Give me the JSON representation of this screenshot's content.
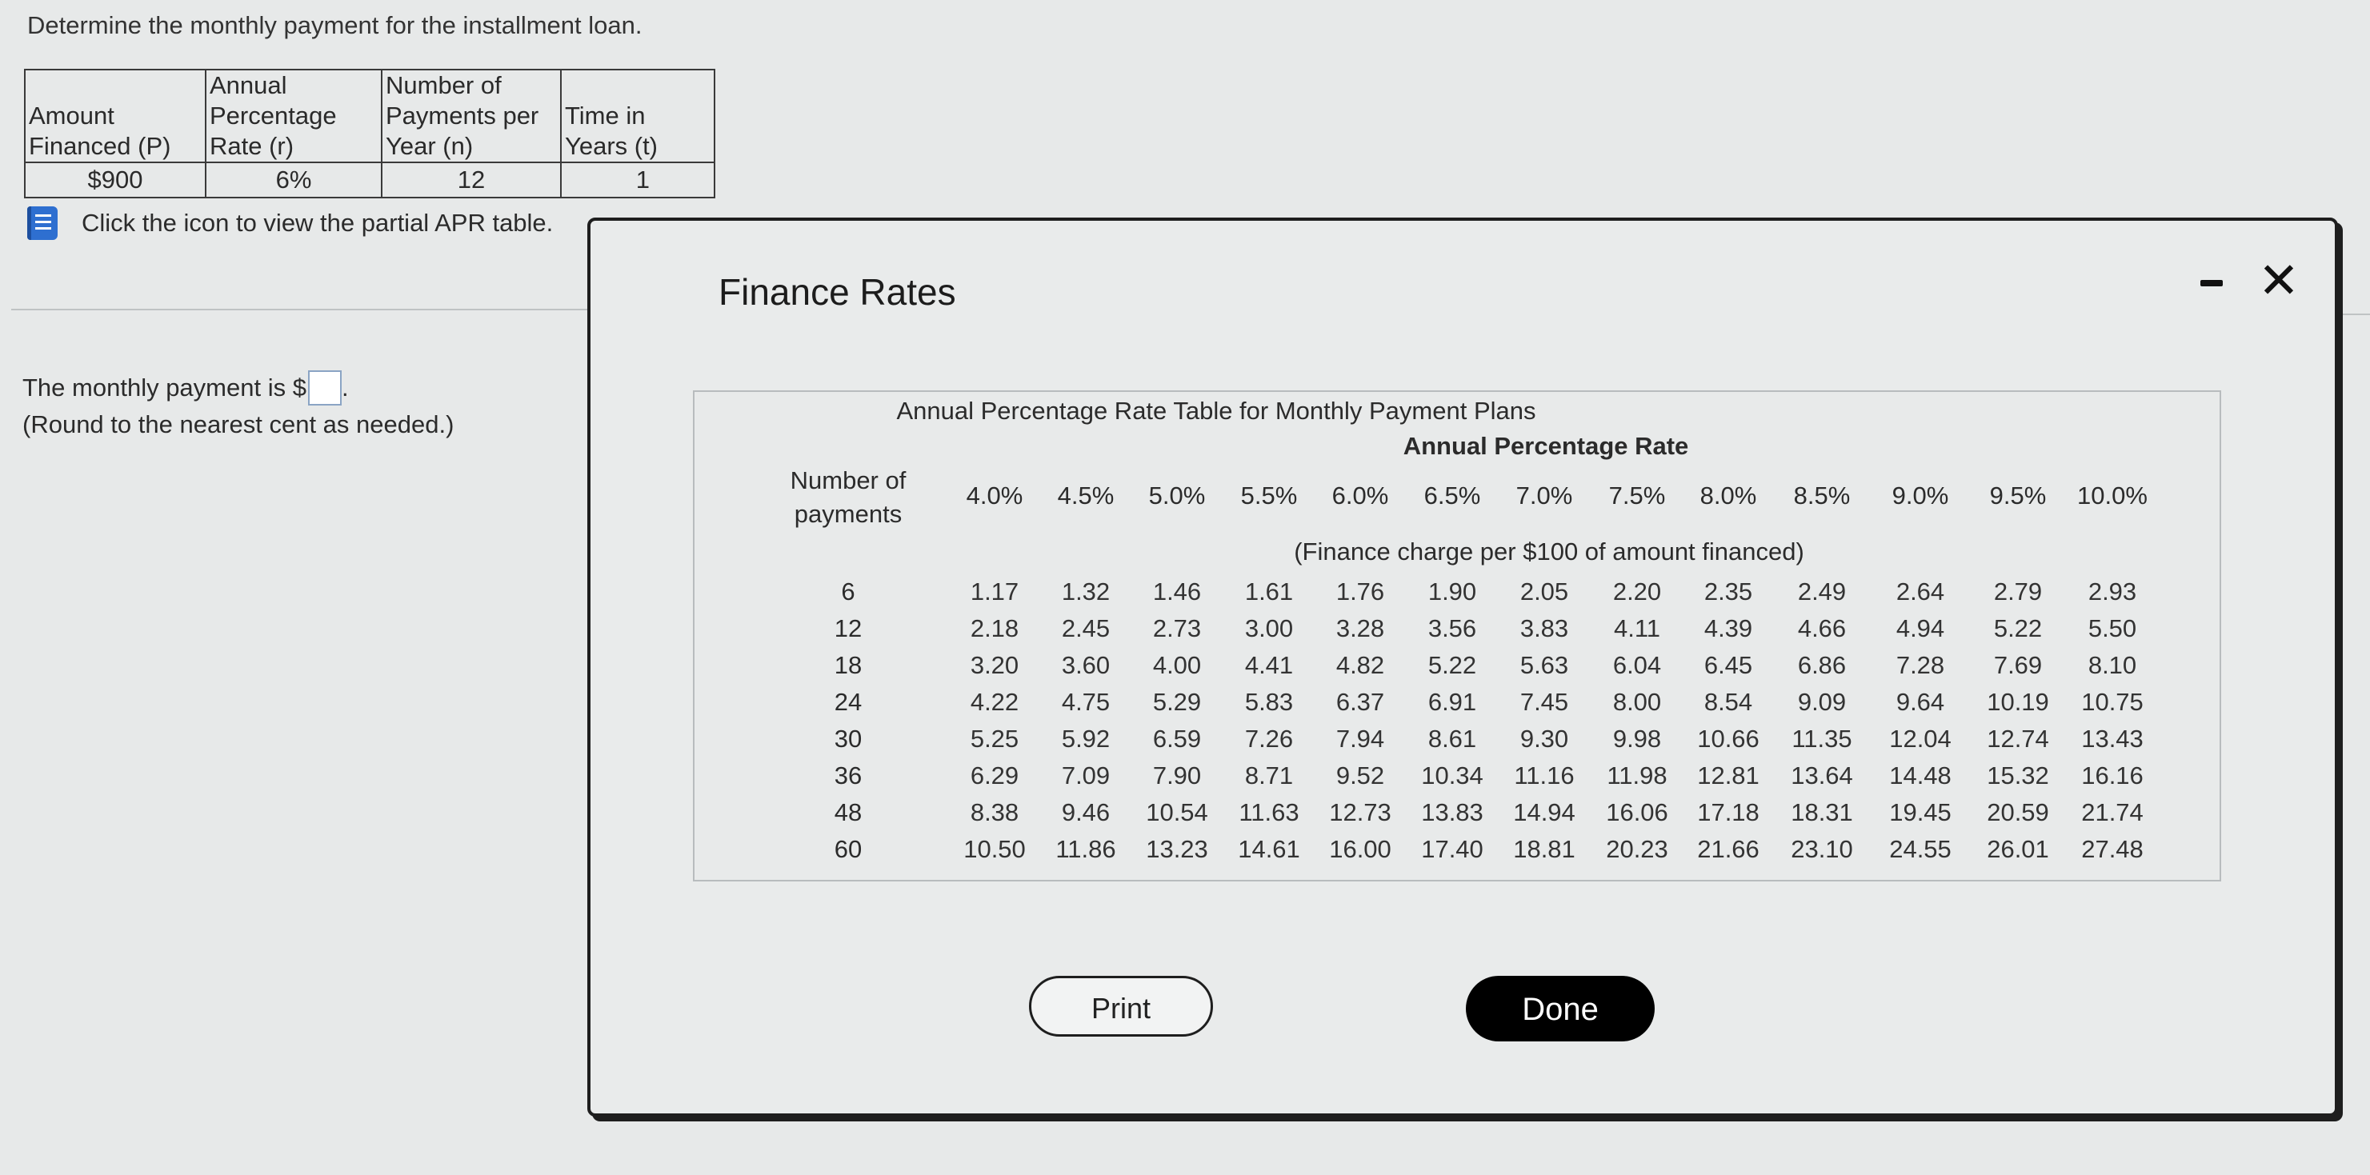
{
  "question": "Determine the monthly payment for the installment loan.",
  "loan_table": {
    "headers": [
      [
        "Amount",
        "Financed (P)"
      ],
      [
        "Annual",
        "Percentage",
        "Rate (r)"
      ],
      [
        "Number of",
        "Payments per",
        "Year (n)"
      ],
      [
        "Time in",
        "Years (t)"
      ]
    ],
    "values": [
      "$900",
      "6%",
      "12",
      "1"
    ]
  },
  "hint": "Click the icon to view the partial APR table.",
  "answer": {
    "prefix": "The monthly payment is $",
    "suffix": ".",
    "note": "(Round to the nearest cent as needed.)",
    "value": ""
  },
  "modal": {
    "title": "Finance Rates",
    "close_symbol": "✕",
    "table": {
      "title": "Annual Percentage Rate Table for Monthly Payment Plans",
      "subtitle": "Annual Percentage Rate",
      "row_header": [
        "Number of",
        "payments"
      ],
      "subheading": "(Finance charge per $100 of amount financed)",
      "rates": [
        "4.0%",
        "4.5%",
        "5.0%",
        "5.5%",
        "6.0%",
        "6.5%",
        "7.0%",
        "7.5%",
        "8.0%",
        "8.5%",
        "9.0%",
        "9.5%",
        "10.0%"
      ],
      "rows": [
        {
          "payments": "6",
          "values": [
            "1.17",
            "1.32",
            "1.46",
            "1.61",
            "1.76",
            "1.90",
            "2.05",
            "2.20",
            "2.35",
            "2.49",
            "2.64",
            "2.79",
            "2.93"
          ]
        },
        {
          "payments": "12",
          "values": [
            "2.18",
            "2.45",
            "2.73",
            "3.00",
            "3.28",
            "3.56",
            "3.83",
            "4.11",
            "4.39",
            "4.66",
            "4.94",
            "5.22",
            "5.50"
          ]
        },
        {
          "payments": "18",
          "values": [
            "3.20",
            "3.60",
            "4.00",
            "4.41",
            "4.82",
            "5.22",
            "5.63",
            "6.04",
            "6.45",
            "6.86",
            "7.28",
            "7.69",
            "8.10"
          ]
        },
        {
          "payments": "24",
          "values": [
            "4.22",
            "4.75",
            "5.29",
            "5.83",
            "6.37",
            "6.91",
            "7.45",
            "8.00",
            "8.54",
            "9.09",
            "9.64",
            "10.19",
            "10.75"
          ]
        },
        {
          "payments": "30",
          "values": [
            "5.25",
            "5.92",
            "6.59",
            "7.26",
            "7.94",
            "8.61",
            "9.30",
            "9.98",
            "10.66",
            "11.35",
            "12.04",
            "12.74",
            "13.43"
          ]
        },
        {
          "payments": "36",
          "values": [
            "6.29",
            "7.09",
            "7.90",
            "8.71",
            "9.52",
            "10.34",
            "11.16",
            "11.98",
            "12.81",
            "13.64",
            "14.48",
            "15.32",
            "16.16"
          ]
        },
        {
          "payments": "48",
          "values": [
            "8.38",
            "9.46",
            "10.54",
            "11.63",
            "12.73",
            "13.83",
            "14.94",
            "16.06",
            "17.18",
            "18.31",
            "19.45",
            "20.59",
            "21.74"
          ]
        },
        {
          "payments": "60",
          "values": [
            "10.50",
            "11.86",
            "13.23",
            "14.61",
            "16.00",
            "17.40",
            "18.81",
            "20.23",
            "21.66",
            "23.10",
            "24.55",
            "26.01",
            "27.48"
          ]
        }
      ]
    },
    "print_label": "Print",
    "done_label": "Done"
  }
}
